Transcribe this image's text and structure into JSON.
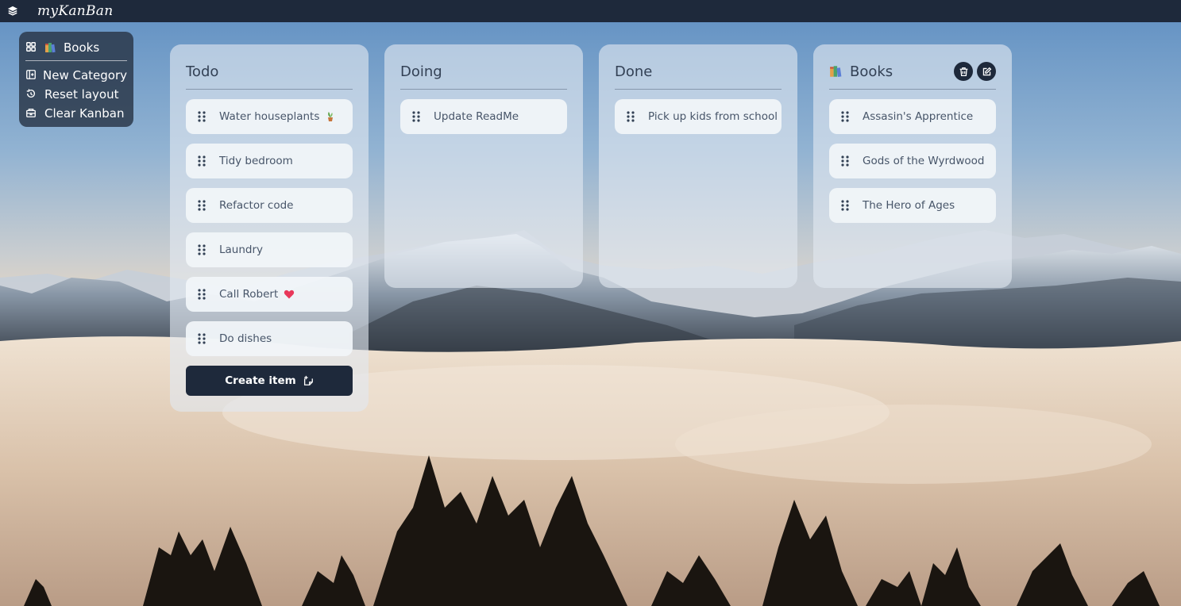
{
  "app": {
    "title": "myKanBan"
  },
  "topbar": {
    "menu_icon": "layers-icon"
  },
  "sidebar": {
    "current_board": "Books",
    "current_board_icon": "books-emoji",
    "items": [
      {
        "label": "New Category",
        "icon": "add-category-icon"
      },
      {
        "label": "Reset layout",
        "icon": "reset-icon"
      },
      {
        "label": "Clear Kanban",
        "icon": "clear-icon"
      }
    ]
  },
  "columns": [
    {
      "title": "Todo",
      "cards": [
        {
          "text": "Water houseplants",
          "emoji": "plant"
        },
        {
          "text": "Tidy bedroom"
        },
        {
          "text": "Refactor code"
        },
        {
          "text": "Laundry"
        },
        {
          "text": "Call Robert",
          "emoji": "heart"
        },
        {
          "text": "Do dishes"
        }
      ],
      "create_label": "Create item"
    },
    {
      "title": "Doing",
      "cards": [
        {
          "text": "Update ReadMe"
        }
      ]
    },
    {
      "title": "Done",
      "cards": [
        {
          "text": "Pick up kids from school"
        }
      ]
    },
    {
      "title": "Books",
      "title_icon": "books-emoji",
      "actions": [
        "trash-icon",
        "edit-icon"
      ],
      "cards": [
        {
          "text": "Assasin's Apprentice"
        },
        {
          "text": "Gods of the Wyrdwood"
        },
        {
          "text": "The Hero of Ages"
        }
      ]
    }
  ],
  "colors": {
    "topbar": "#1e293b",
    "button": "#1e293b",
    "column_bg": "#e2e8f0",
    "card_bg": "#f1f5f9",
    "text": "#475569"
  }
}
